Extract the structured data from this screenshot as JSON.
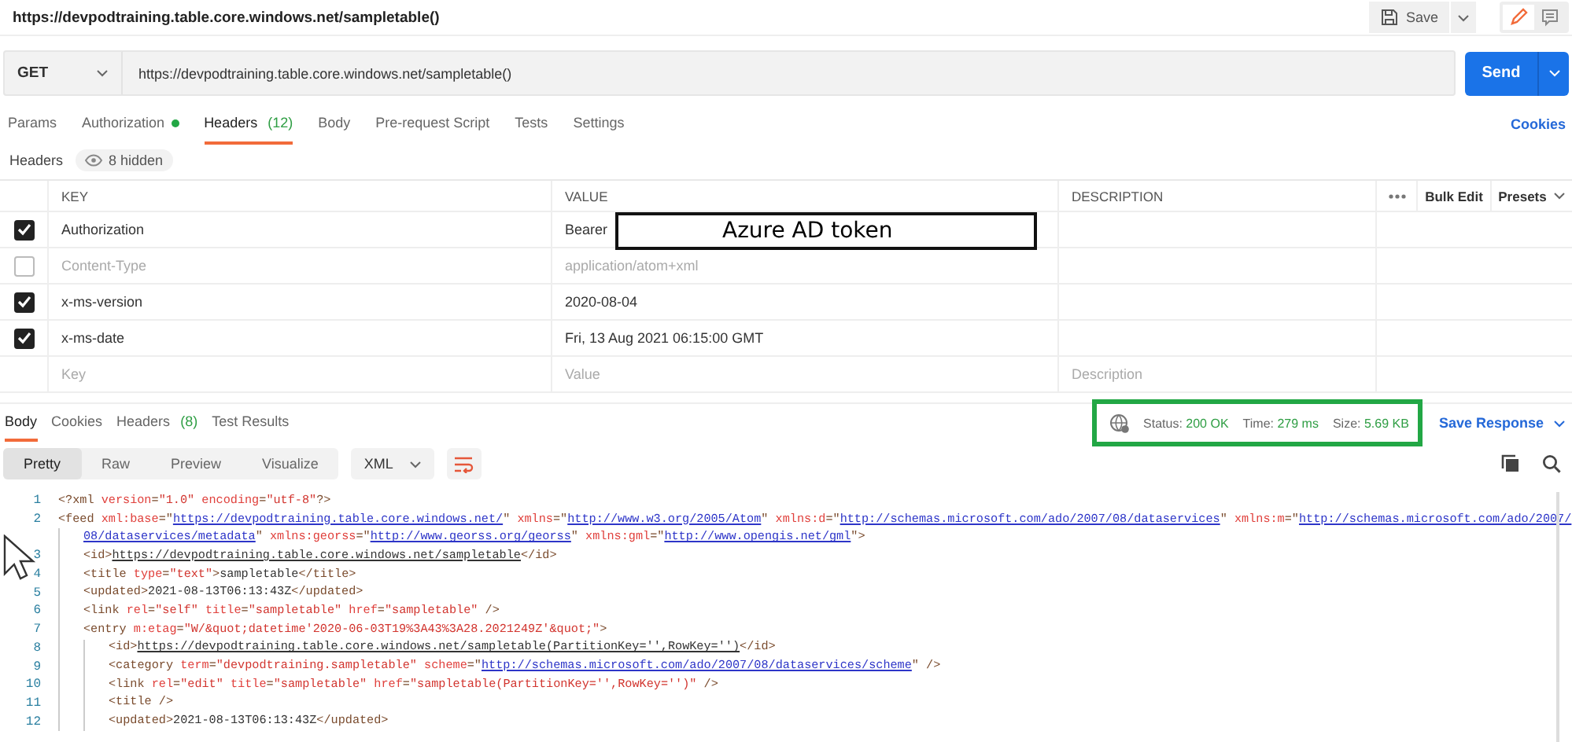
{
  "request_title": "https://devpodtraining.table.core.windows.net/sampletable()",
  "save_button": "Save",
  "method": "GET",
  "url": "https://devpodtraining.table.core.windows.net/sampletable()",
  "send_button": "Send",
  "request_tabs": [
    {
      "label": "Params",
      "selected": false,
      "indicator": false
    },
    {
      "label": "Authorization",
      "selected": false,
      "indicator": true
    },
    {
      "label": "Headers",
      "count": "(12)",
      "selected": true,
      "indicator": false
    },
    {
      "label": "Body",
      "selected": false,
      "indicator": false
    },
    {
      "label": "Pre-request Script",
      "selected": false,
      "indicator": false
    },
    {
      "label": "Tests",
      "selected": false,
      "indicator": false
    },
    {
      "label": "Settings",
      "selected": false,
      "indicator": false
    }
  ],
  "cookies_link": "Cookies",
  "headers_label": "Headers",
  "hidden_badge": "8 hidden",
  "table": {
    "columns": [
      "KEY",
      "VALUE",
      "DESCRIPTION"
    ],
    "bulk_edit": "Bulk Edit",
    "presets": "Presets",
    "rows": [
      {
        "checked": true,
        "key": "Authorization",
        "value": "Bearer"
      },
      {
        "checked": false,
        "key": "Content-Type",
        "value": "application/atom+xml"
      },
      {
        "checked": true,
        "key": "x-ms-version",
        "value": "2020-08-04"
      },
      {
        "checked": true,
        "key": "x-ms-date",
        "value": "Fri, 13 Aug 2021 06:15:00 GMT"
      }
    ],
    "placeholders": {
      "key": "Key",
      "value": "Value",
      "description": "Description"
    }
  },
  "annotation": "Azure AD token",
  "response_tabs": [
    {
      "label": "Body",
      "selected": true
    },
    {
      "label": "Cookies",
      "selected": false
    },
    {
      "label": "Headers",
      "count": "(8)",
      "selected": false
    },
    {
      "label": "Test Results",
      "selected": false
    }
  ],
  "status": [
    {
      "label": "Status:",
      "value": "200 OK"
    },
    {
      "label": "Time:",
      "value": "279 ms"
    },
    {
      "label": "Size:",
      "value": "5.69 KB"
    }
  ],
  "save_response": "Save Response",
  "view_modes": [
    {
      "label": "Pretty",
      "selected": true
    },
    {
      "label": "Raw",
      "selected": false
    },
    {
      "label": "Preview",
      "selected": false
    },
    {
      "label": "Visualize",
      "selected": false
    }
  ],
  "format": "XML",
  "code": [
    {
      "number": "1",
      "tokens": [
        {
          "kind": "p",
          "text": "<?xml "
        },
        {
          "kind": "a",
          "text": "version"
        },
        {
          "kind": "p",
          "text": "="
        },
        {
          "kind": "s",
          "text": "\"1.0\" "
        },
        {
          "kind": "a",
          "text": "encoding"
        },
        {
          "kind": "p",
          "text": "="
        },
        {
          "kind": "s",
          "text": "\"utf-8\""
        },
        {
          "kind": "p",
          "text": "?>"
        }
      ]
    },
    {
      "number": "2",
      "tokens": [
        {
          "kind": "p",
          "text": "<feed "
        },
        {
          "kind": "a",
          "text": "xml:base"
        },
        {
          "kind": "p",
          "text": "=\""
        },
        {
          "kind": "u",
          "text": "https://devpodtraining.table.core.windows.net/"
        },
        {
          "kind": "p",
          "text": "\" "
        },
        {
          "kind": "a",
          "text": "xmlns"
        },
        {
          "kind": "p",
          "text": "=\""
        },
        {
          "kind": "u",
          "text": "http://www.w3.org/2005/Atom"
        },
        {
          "kind": "p",
          "text": "\" "
        },
        {
          "kind": "a",
          "text": "xmlns:d"
        },
        {
          "kind": "p",
          "text": "=\""
        },
        {
          "kind": "u",
          "text": "http://schemas.microsoft.com/ado/2007/08/dataservices"
        },
        {
          "kind": "p",
          "text": "\" "
        },
        {
          "kind": "a",
          "text": "xmlns:m"
        },
        {
          "kind": "p",
          "text": "=\""
        },
        {
          "kind": "u",
          "text": "http://schemas.microsoft.com/ado/2007/"
        }
      ],
      "continuation": {
        "tokens": [
          {
            "kind": "u",
            "text": "08/dataservices/metadata"
          },
          {
            "kind": "p",
            "text": "\" "
          },
          {
            "kind": "a",
            "text": "xmlns:georss"
          },
          {
            "kind": "p",
            "text": "=\""
          },
          {
            "kind": "u",
            "text": "http://www.georss.org/georss"
          },
          {
            "kind": "p",
            "text": "\" "
          },
          {
            "kind": "a",
            "text": "xmlns:gml"
          },
          {
            "kind": "p",
            "text": "=\""
          },
          {
            "kind": "u",
            "text": "http://www.opengis.net/gml"
          },
          {
            "kind": "p",
            "text": "\">"
          }
        ]
      },
      "children": [
        {
          "number": "3",
          "tokens": [
            {
              "kind": "p",
              "text": "<id>"
            },
            {
              "kind": "l",
              "text": "https://devpodtraining.table.core.windows.net/sampletable"
            },
            {
              "kind": "p",
              "text": "</id>"
            }
          ]
        },
        {
          "number": "4",
          "tokens": [
            {
              "kind": "p",
              "text": "<title "
            },
            {
              "kind": "a",
              "text": "type"
            },
            {
              "kind": "p",
              "text": "="
            },
            {
              "kind": "s",
              "text": "\"text\""
            },
            {
              "kind": "p",
              "text": ">"
            },
            {
              "kind": "t",
              "text": "sampletable"
            },
            {
              "kind": "p",
              "text": "</title>"
            }
          ]
        },
        {
          "number": "5",
          "tokens": [
            {
              "kind": "p",
              "text": "<updated>"
            },
            {
              "kind": "t",
              "text": "2021-08-13T06:13:43Z"
            },
            {
              "kind": "p",
              "text": "</updated>"
            }
          ]
        },
        {
          "number": "6",
          "tokens": [
            {
              "kind": "p",
              "text": "<link "
            },
            {
              "kind": "a",
              "text": "rel"
            },
            {
              "kind": "p",
              "text": "="
            },
            {
              "kind": "s",
              "text": "\"self\" "
            },
            {
              "kind": "a",
              "text": "title"
            },
            {
              "kind": "p",
              "text": "="
            },
            {
              "kind": "s",
              "text": "\"sampletable\" "
            },
            {
              "kind": "a",
              "text": "href"
            },
            {
              "kind": "p",
              "text": "="
            },
            {
              "kind": "s",
              "text": "\"sampletable\""
            },
            {
              "kind": "p",
              "text": " />"
            }
          ]
        },
        {
          "number": "7",
          "tokens": [
            {
              "kind": "p",
              "text": "<entry "
            },
            {
              "kind": "a",
              "text": "m:etag"
            },
            {
              "kind": "p",
              "text": "="
            },
            {
              "kind": "s",
              "text": "\"W/&quot;datetime'2020-06-03T19%3A43%3A28.2021249Z'&quot;\""
            },
            {
              "kind": "p",
              "text": ">"
            }
          ],
          "children": [
            {
              "number": "8",
              "tokens": [
                {
                  "kind": "p",
                  "text": "<id>"
                },
                {
                  "kind": "l",
                  "text": "https://devpodtraining.table.core.windows.net/sampletable(PartitionKey='',RowKey='')"
                },
                {
                  "kind": "p",
                  "text": "</id>"
                }
              ]
            },
            {
              "number": "9",
              "tokens": [
                {
                  "kind": "p",
                  "text": "<category "
                },
                {
                  "kind": "a",
                  "text": "term"
                },
                {
                  "kind": "p",
                  "text": "="
                },
                {
                  "kind": "s",
                  "text": "\"devpodtraining.sampletable\" "
                },
                {
                  "kind": "a",
                  "text": "scheme"
                },
                {
                  "kind": "p",
                  "text": "=\""
                },
                {
                  "kind": "u",
                  "text": "http://schemas.microsoft.com/ado/2007/08/dataservices/scheme"
                },
                {
                  "kind": "p",
                  "text": "\" />"
                }
              ]
            },
            {
              "number": "10",
              "tokens": [
                {
                  "kind": "p",
                  "text": "<link "
                },
                {
                  "kind": "a",
                  "text": "rel"
                },
                {
                  "kind": "p",
                  "text": "="
                },
                {
                  "kind": "s",
                  "text": "\"edit\" "
                },
                {
                  "kind": "a",
                  "text": "title"
                },
                {
                  "kind": "p",
                  "text": "="
                },
                {
                  "kind": "s",
                  "text": "\"sampletable\" "
                },
                {
                  "kind": "a",
                  "text": "href"
                },
                {
                  "kind": "p",
                  "text": "="
                },
                {
                  "kind": "s",
                  "text": "\"sampletable(PartitionKey='',RowKey='')\""
                },
                {
                  "kind": "p",
                  "text": " />"
                }
              ]
            },
            {
              "number": "11",
              "tokens": [
                {
                  "kind": "p",
                  "text": "<title />"
                }
              ]
            },
            {
              "number": "12",
              "tokens": [
                {
                  "kind": "p",
                  "text": "<updated>"
                },
                {
                  "kind": "t",
                  "text": "2021-08-13T06:13:43Z"
                },
                {
                  "kind": "p",
                  "text": "</updated>"
                }
              ]
            }
          ]
        }
      ]
    }
  ]
}
